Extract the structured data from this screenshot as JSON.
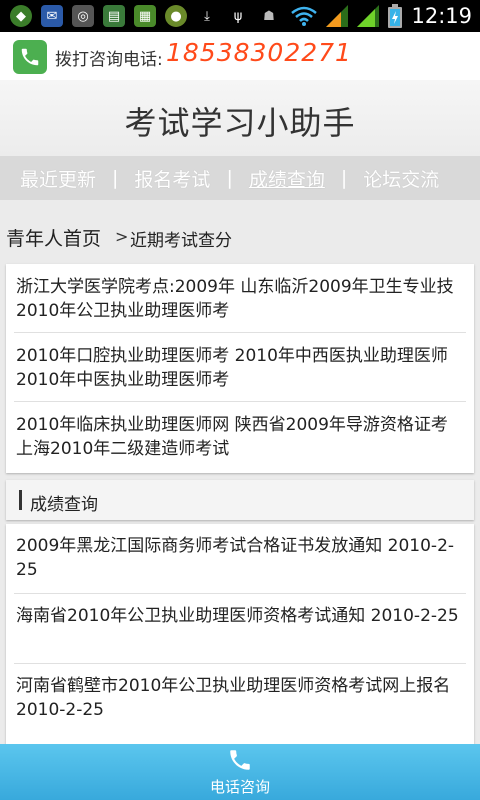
{
  "status_bar": {
    "time": "12:19",
    "left_icons": [
      "app-icon-1",
      "app-icon-2",
      "app-icon-3",
      "app-icon-4",
      "app-icon-5",
      "app-icon-6",
      "download-icon",
      "usb-icon",
      "android-icon"
    ],
    "right_icons": [
      "wifi-icon",
      "signal-icon-1",
      "signal-icon-2",
      "battery-icon"
    ]
  },
  "phone_bar": {
    "label": "拨打咨询电话:",
    "number": "18538302271"
  },
  "header": {
    "title": "考试学习小助手"
  },
  "nav": {
    "items": [
      {
        "label": "最近更新"
      },
      {
        "label": "报名考试"
      },
      {
        "label": "成绩查询"
      },
      {
        "label": "论坛交流"
      }
    ],
    "separator": "|"
  },
  "breadcrumb": {
    "home": "青年人首页",
    "separator": ">",
    "current": "近期考试查分"
  },
  "links_panel": {
    "items": [
      "浙江大学医学院考点:2009年 山东临沂2009年卫生专业技 2010年公卫执业助理医师考",
      "2010年口腔执业助理医师考 2010年中西医执业助理医师 2010年中医执业助理医师考",
      "2010年临床执业助理医师网 陕西省2009年导游资格证考 上海2010年二级建造师考试"
    ]
  },
  "section": {
    "title": "成绩查询"
  },
  "news_panel": {
    "items": [
      "2009年黑龙江国际商务师考试合格证书发放通知 2010-2-25",
      "海南省2010年公卫执业助理医师资格考试通知 2010-2-25",
      "河南省鹤壁市2010年公卫执业助理医师资格考试网上报名 2010-2-25"
    ]
  },
  "bottom_bar": {
    "label": "电话咨询"
  },
  "colors": {
    "phone_number": "#ff4a1a",
    "phone_icon_bg": "#4caf50",
    "bottom_bar": "#4ab8e6",
    "nav_bg": "#d9d9d9"
  }
}
